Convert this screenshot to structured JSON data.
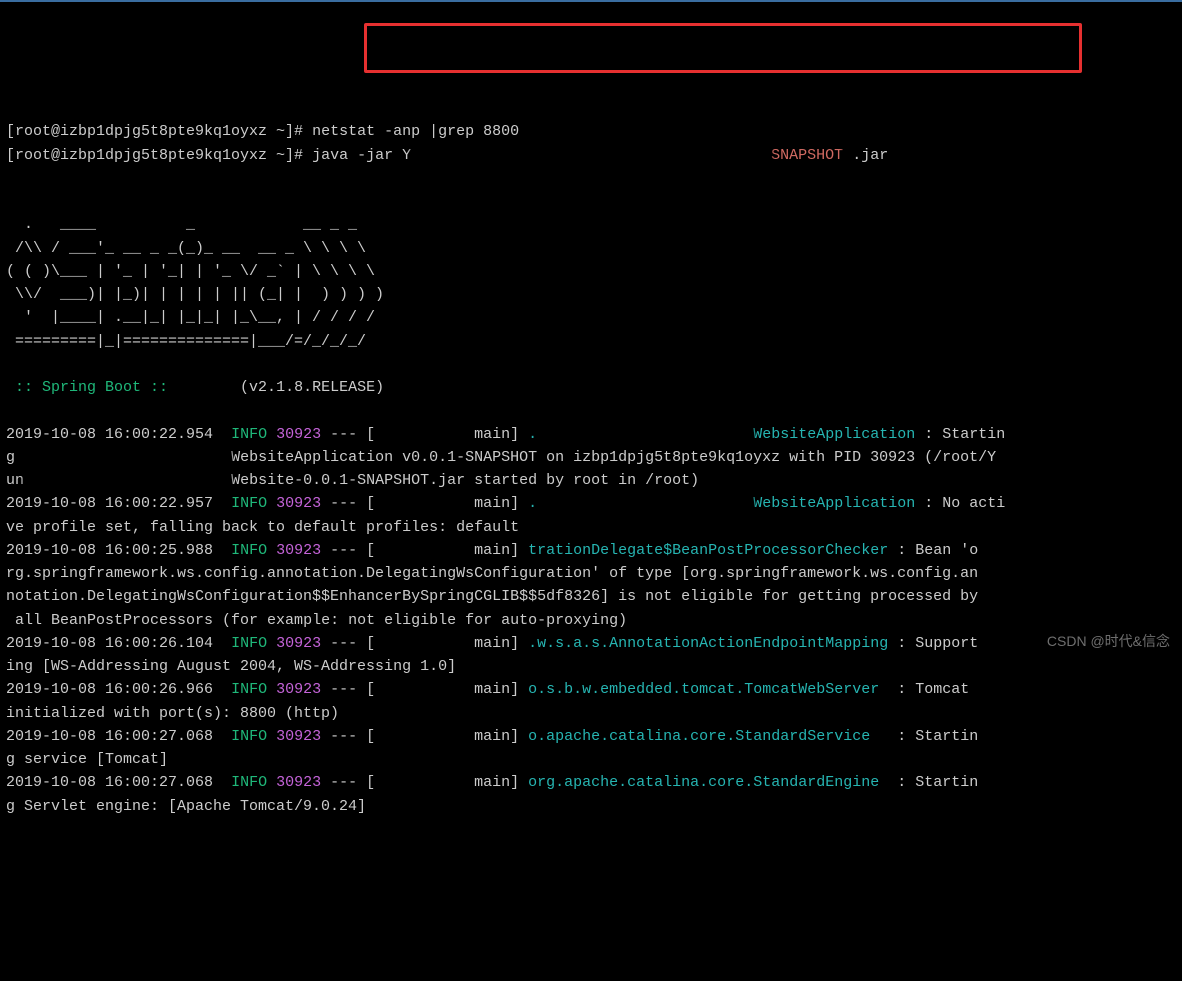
{
  "prompt1": {
    "userhost": "[root@izbp1dpjg5t8pte9kq1oyxz ~]#",
    "cmd": "netstat -anp |grep 8800"
  },
  "prompt2": {
    "userhost": "[root@izbp1dpjg5t8pte9kq1oyxz ~]#",
    "cmd_a": "java -jar Y",
    "cmd_b": "SNAPSHOT",
    "cmd_c": ".jar"
  },
  "ascii": "  .   ____          _            __ _ _\n /\\\\ / ___'_ __ _ _(_)_ __  __ _ \\ \\ \\ \\\n( ( )\\___ | '_ | '_| | '_ \\/ _` | \\ \\ \\ \\\n \\\\/  ___)| |_)| | | | | || (_| |  ) ) ) )\n  '  |____| .__|_| |_|_| |_\\__, | / / / /\n =========|_|==============|___/=/_/_/_/",
  "springboot": {
    "name": " :: Spring Boot :: ",
    "version": "       (v2.1.8.RELEASE)"
  },
  "logs": [
    {
      "date": "2019-10-08 16:00:22.954",
      "level": "INFO",
      "pid": "30923",
      "sep": " --- [",
      "thread": "           main] ",
      "logger_a": ".",
      "logger_b": "WebsiteApplication",
      "msg_a": " : Startin",
      "msg_b": "g ",
      "msg_c": "WebsiteApplication v0.0.1-SNAPSHOT on izbp1dpjg5t8pte9kq1oyxz with PID 30923 (/root/Y",
      "msg_d": "un",
      "msg_e": "Website-0.0.1-SNAPSHOT.jar started by root in /root)"
    },
    {
      "date": "2019-10-08 16:00:22.957",
      "level": "INFO",
      "pid": "30923",
      "sep": " --- [",
      "thread": "           main] ",
      "logger_a": ".",
      "logger_b": "WebsiteApplication",
      "msg_a": " : No acti",
      "msg_b": "ve profile set, falling back to default profiles: default"
    },
    {
      "date": "2019-10-08 16:00:25.988",
      "level": "INFO",
      "pid": "30923",
      "sep": " --- [",
      "thread": "           main] ",
      "logger": "trationDelegate$BeanPostProcessorChecker",
      "msg_a": " : Bean 'o",
      "msg_b": "rg.springframework.ws.config.annotation.DelegatingWsConfiguration' of type [org.springframework.ws.config.an",
      "msg_c": "notation.DelegatingWsConfiguration$$EnhancerBySpringCGLIB$$5df8326] is not eligible for getting processed by",
      "msg_d": " all BeanPostProcessors (for example: not eligible for auto-proxying)"
    },
    {
      "date": "2019-10-08 16:00:26.104",
      "level": "INFO",
      "pid": "30923",
      "sep": " --- [",
      "thread": "           main] ",
      "logger": ".w.s.a.s.AnnotationActionEndpointMapping",
      "msg_a": " : Support",
      "msg_b": "ing [WS-Addressing August 2004, WS-Addressing 1.0]"
    },
    {
      "date": "2019-10-08 16:00:26.966",
      "level": "INFO",
      "pid": "30923",
      "sep": " --- [",
      "thread": "           main] ",
      "logger": "o.s.b.w.embedded.tomcat.TomcatWebServer ",
      "msg_a": " : Tomcat ",
      "msg_b": "initialized with port(s): 8800 (http)"
    },
    {
      "date": "2019-10-08 16:00:27.068",
      "level": "INFO",
      "pid": "30923",
      "sep": " --- [",
      "thread": "           main] ",
      "logger": "o.apache.catalina.core.StandardService  ",
      "msg_a": " : Startin",
      "msg_b": "g service [Tomcat]"
    },
    {
      "date": "2019-10-08 16:00:27.068",
      "level": "INFO",
      "pid": "30923",
      "sep": " --- [",
      "thread": "           main] ",
      "logger": "org.apache.catalina.core.StandardEngine ",
      "msg_a": " : Startin",
      "msg_b": "g Servlet engine: [Apache Tomcat/9.0.24]"
    }
  ],
  "watermark": "CSDN @时代&信念"
}
